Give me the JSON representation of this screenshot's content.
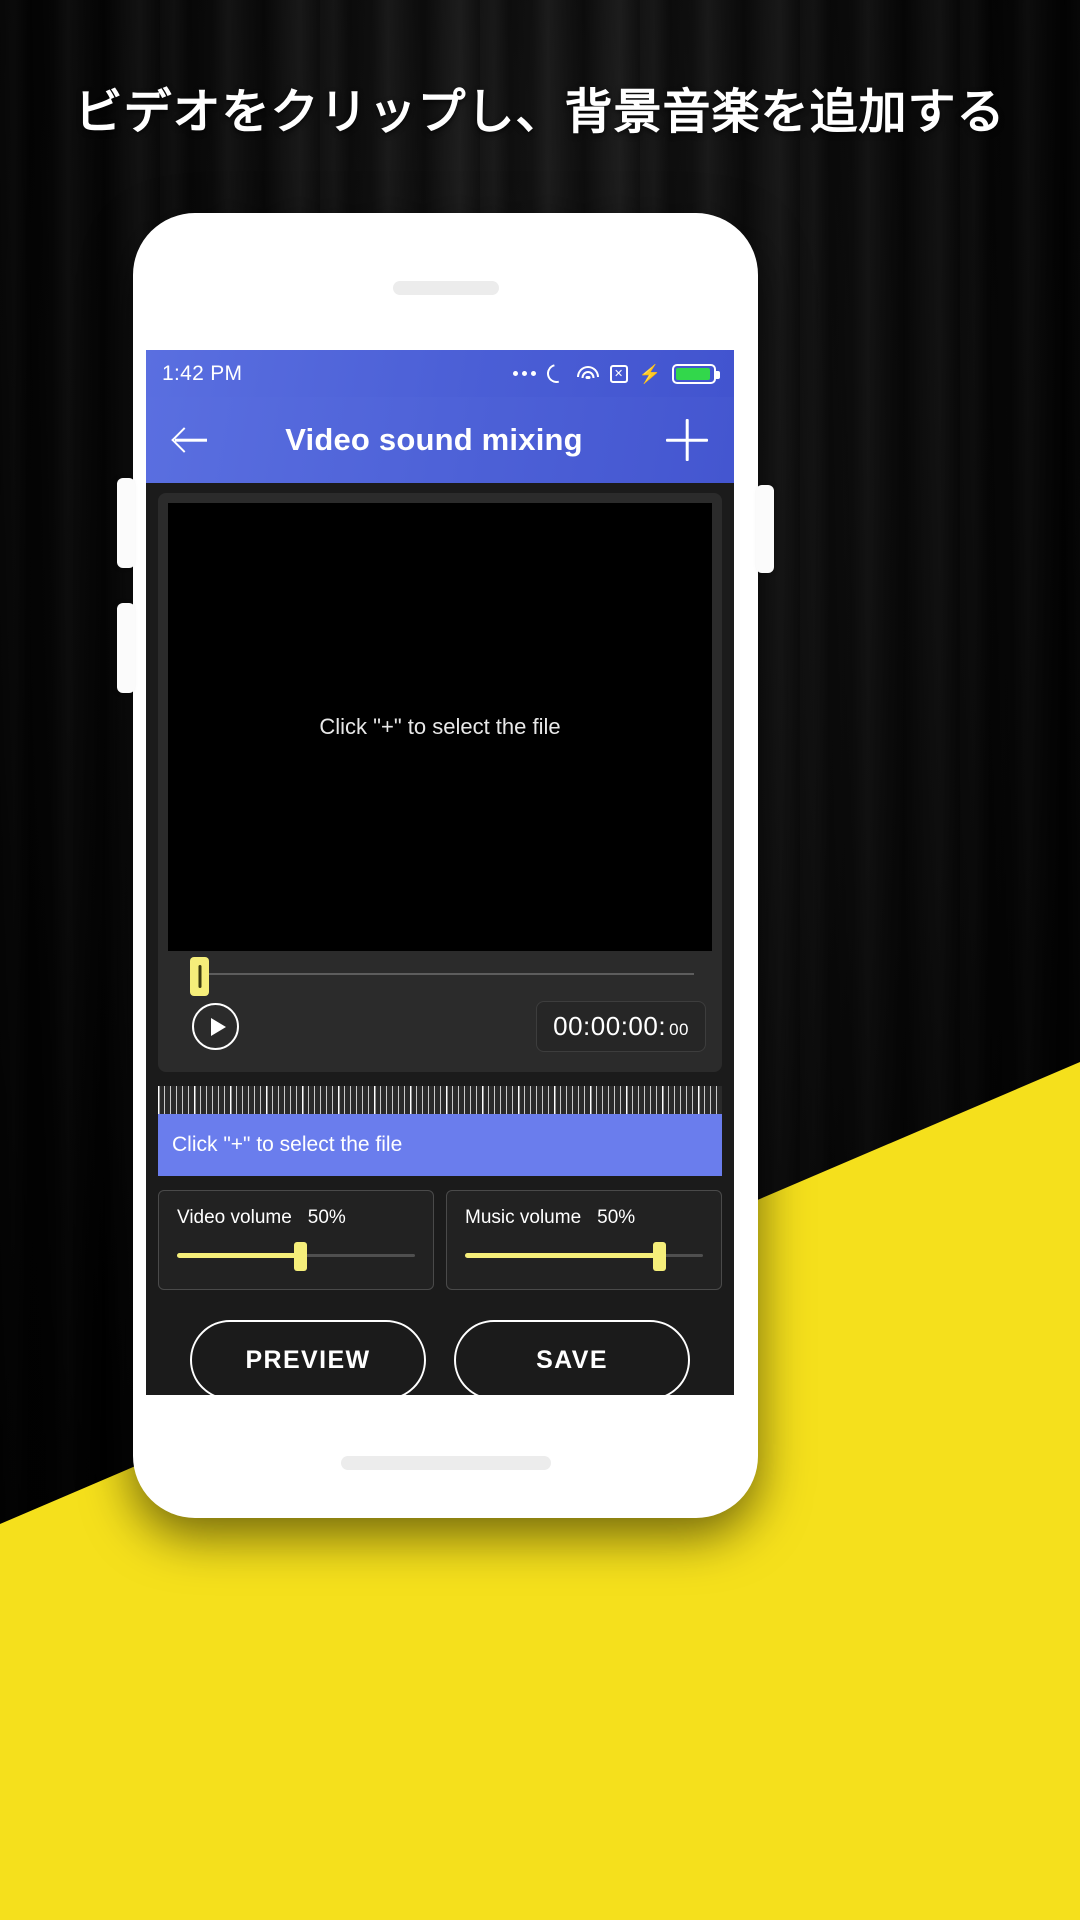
{
  "headline": "ビデオをクリップし、背景音楽を追加する",
  "status_bar": {
    "time": "1:42 PM",
    "icons": [
      "more-dots",
      "sync",
      "wifi",
      "no-sim",
      "charging-bolt",
      "battery"
    ]
  },
  "app_bar": {
    "back_icon": "back-arrow-icon",
    "title": "Video sound mixing",
    "add_icon": "plus-icon"
  },
  "player": {
    "placeholder": "Click \"+\" to select the file",
    "play_icon": "play-icon",
    "timecode": "00:00:00:",
    "timecode_ms": "00",
    "seek_position_pct": 0
  },
  "timeline": {
    "clip_label": "Click \"+\" to select the file"
  },
  "volumes": [
    {
      "label": "Video volume",
      "value": "50%",
      "percent": 50
    },
    {
      "label": "Music volume",
      "value": "50%",
      "percent": 50
    }
  ],
  "actions": {
    "preview": "PREVIEW",
    "save": "SAVE"
  },
  "colors": {
    "accent_blue": "#5a6fe0",
    "clip_blue": "#6a7ded",
    "yellow": "#F5EE7A",
    "brand_yellow": "#F5E01C",
    "panel_dark": "#1b1b1b"
  }
}
